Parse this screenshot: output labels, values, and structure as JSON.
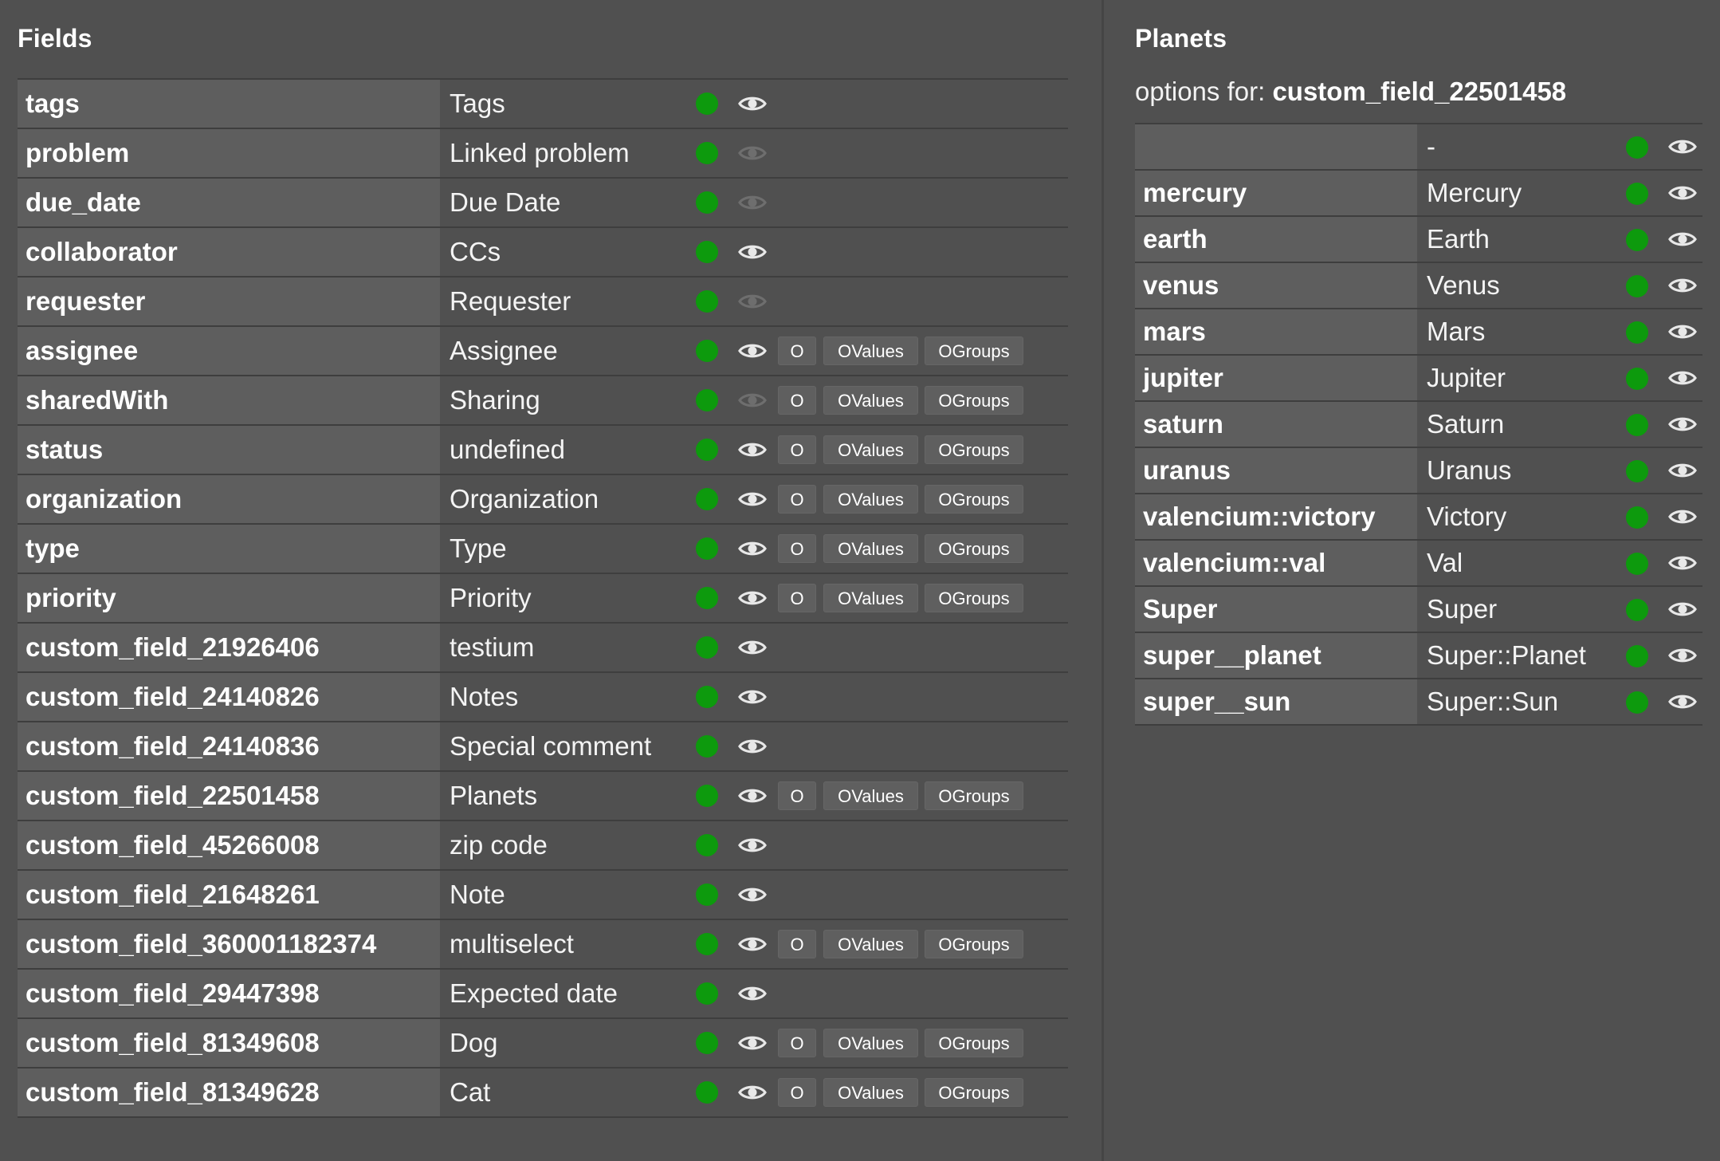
{
  "fields_panel": {
    "title": "Fields",
    "button_labels": {
      "o": "O",
      "values": "OValues",
      "groups": "OGroups"
    },
    "rows": [
      {
        "key": "tags",
        "label": "Tags",
        "active": true,
        "visible": true,
        "has_options": false
      },
      {
        "key": "problem",
        "label": "Linked problem",
        "active": true,
        "visible": false,
        "has_options": false
      },
      {
        "key": "due_date",
        "label": "Due Date",
        "active": true,
        "visible": false,
        "has_options": false
      },
      {
        "key": "collaborator",
        "label": "CCs",
        "active": true,
        "visible": true,
        "has_options": false
      },
      {
        "key": "requester",
        "label": "Requester",
        "active": true,
        "visible": false,
        "has_options": false
      },
      {
        "key": "assignee",
        "label": "Assignee",
        "active": true,
        "visible": true,
        "has_options": true
      },
      {
        "key": "sharedWith",
        "label": "Sharing",
        "active": true,
        "visible": false,
        "has_options": true
      },
      {
        "key": "status",
        "label": "undefined",
        "active": true,
        "visible": true,
        "has_options": true
      },
      {
        "key": "organization",
        "label": "Organization",
        "active": true,
        "visible": true,
        "has_options": true
      },
      {
        "key": "type",
        "label": "Type",
        "active": true,
        "visible": true,
        "has_options": true
      },
      {
        "key": "priority",
        "label": "Priority",
        "active": true,
        "visible": true,
        "has_options": true
      },
      {
        "key": "custom_field_21926406",
        "label": "testium",
        "active": true,
        "visible": true,
        "has_options": false
      },
      {
        "key": "custom_field_24140826",
        "label": "Notes",
        "active": true,
        "visible": true,
        "has_options": false
      },
      {
        "key": "custom_field_24140836",
        "label": "Special comment",
        "active": true,
        "visible": true,
        "has_options": false
      },
      {
        "key": "custom_field_22501458",
        "label": "Planets",
        "active": true,
        "visible": true,
        "has_options": true
      },
      {
        "key": "custom_field_45266008",
        "label": "zip code",
        "active": true,
        "visible": true,
        "has_options": false
      },
      {
        "key": "custom_field_21648261",
        "label": "Note",
        "active": true,
        "visible": true,
        "has_options": false
      },
      {
        "key": "custom_field_360001182374",
        "label": "multiselect",
        "active": true,
        "visible": true,
        "has_options": true
      },
      {
        "key": "custom_field_29447398",
        "label": "Expected date",
        "active": true,
        "visible": true,
        "has_options": false
      },
      {
        "key": "custom_field_81349608",
        "label": "Dog",
        "active": true,
        "visible": true,
        "has_options": true
      },
      {
        "key": "custom_field_81349628",
        "label": "Cat",
        "active": true,
        "visible": true,
        "has_options": true
      }
    ]
  },
  "options_panel": {
    "title": "Planets",
    "caption_prefix": "options for: ",
    "field_name": "custom_field_22501458",
    "rows": [
      {
        "key": "",
        "label": "-",
        "active": true,
        "visible": true
      },
      {
        "key": "mercury",
        "label": "Mercury",
        "active": true,
        "visible": true
      },
      {
        "key": "earth",
        "label": "Earth",
        "active": true,
        "visible": true
      },
      {
        "key": "venus",
        "label": "Venus",
        "active": true,
        "visible": true
      },
      {
        "key": "mars",
        "label": "Mars",
        "active": true,
        "visible": true
      },
      {
        "key": "jupiter",
        "label": "Jupiter",
        "active": true,
        "visible": true
      },
      {
        "key": "saturn",
        "label": "Saturn",
        "active": true,
        "visible": true
      },
      {
        "key": "uranus",
        "label": "Uranus",
        "active": true,
        "visible": true
      },
      {
        "key": "valencium::victory",
        "label": "Victory",
        "active": true,
        "visible": true
      },
      {
        "key": "valencium::val",
        "label": "Val",
        "active": true,
        "visible": true
      },
      {
        "key": "Super",
        "label": "Super",
        "active": true,
        "visible": true
      },
      {
        "key": "super__planet",
        "label": "Super::Planet",
        "active": true,
        "visible": true
      },
      {
        "key": "super__sun",
        "label": "Super::Sun",
        "active": true,
        "visible": true
      }
    ]
  },
  "colors": {
    "background": "#505050",
    "key_cell": "#5e5e5e",
    "active_dot": "#0d9a0d",
    "eye_visible": "#e8e8e8",
    "eye_hidden": "#6e6e6e"
  },
  "icons": {
    "status": "status-dot-icon",
    "visibility": "eye-icon"
  }
}
